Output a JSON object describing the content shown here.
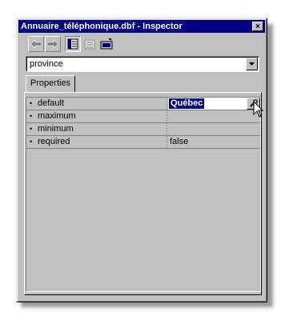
{
  "window": {
    "title": "Annuaire_téléphonique.dbf - Inspector",
    "close_glyph": "×"
  },
  "toolbar": {
    "buttons": [
      {
        "icon": "back-arrow-icon",
        "enabled": false
      },
      {
        "icon": "forward-arrow-icon",
        "enabled": false
      },
      {
        "icon": "properties-view-icon",
        "pressed": true
      },
      {
        "icon": "events-view-icon",
        "enabled": false
      },
      {
        "icon": "methods-view-icon",
        "enabled": true
      }
    ]
  },
  "object_selector": {
    "value": "province"
  },
  "tabs": [
    {
      "label": "Properties",
      "active": true
    }
  ],
  "properties": [
    {
      "bullet": "•",
      "name": "default",
      "value": "Québec",
      "editing": true
    },
    {
      "bullet": "•",
      "name": "maximum",
      "value": ""
    },
    {
      "bullet": "•",
      "name": "minimum",
      "value": ""
    },
    {
      "bullet": "•",
      "name": "required",
      "value": "false"
    }
  ],
  "colors": {
    "titlebar": "#000080",
    "face": "#c0c0c0",
    "selection": "#000080"
  }
}
